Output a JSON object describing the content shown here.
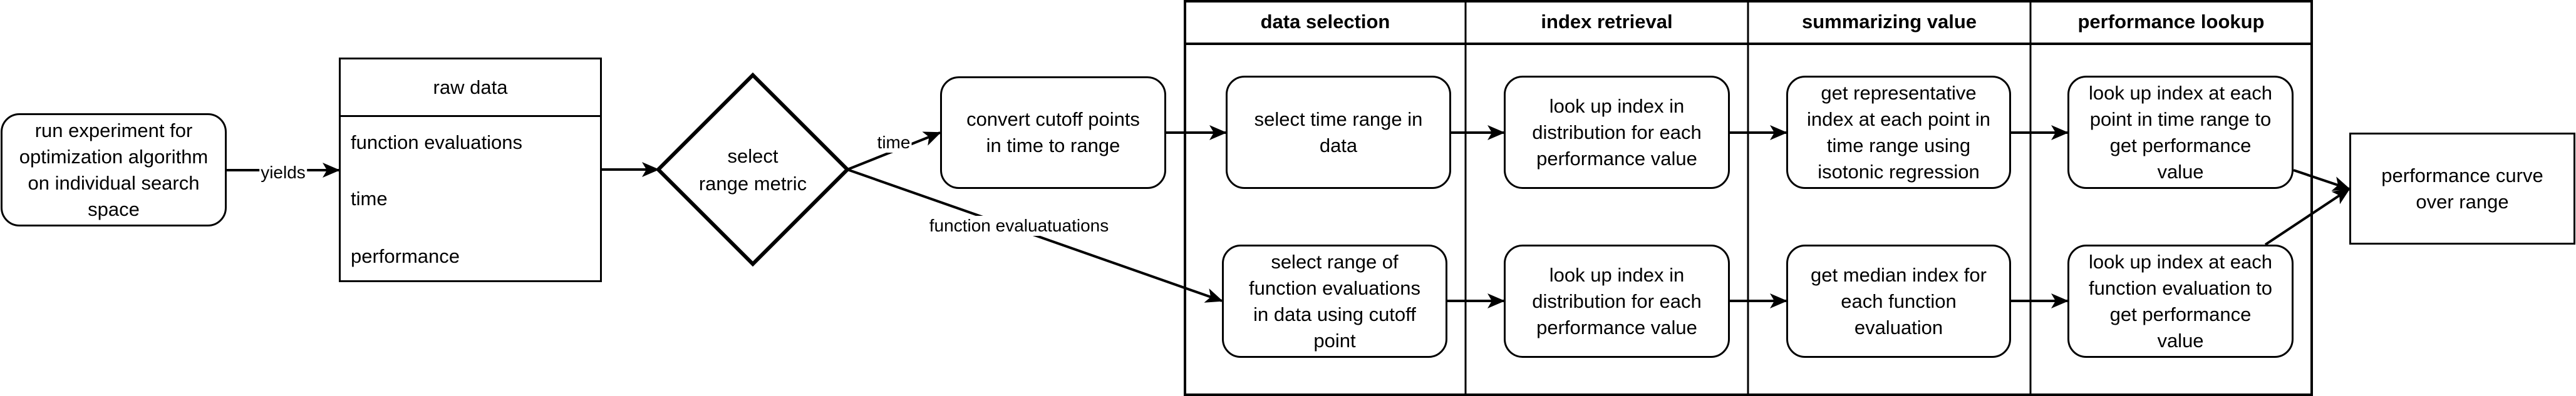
{
  "diagram": {
    "start_node": "run experiment for\noptimization algorithm\non individual search\nspace",
    "edge_yields": "yields",
    "raw_data": {
      "title": "raw data",
      "fields": [
        "function evaluations",
        "time",
        "performance"
      ]
    },
    "decision": "select\nrange metric",
    "edge_time": "time",
    "edge_function_evaluations": "function evaluatuations",
    "convert_node": "convert cutoff points\nin time to range",
    "lanes": [
      {
        "header": "data selection",
        "time_node": "select time range in\ndata",
        "fe_node": "select range of\nfunction evaluations\nin data using cutoff\npoint"
      },
      {
        "header": "index retrieval",
        "time_node": "look up index in\ndistribution for each\nperformance value",
        "fe_node": "look up index in\ndistribution for each\nperformance value"
      },
      {
        "header": "summarizing value",
        "time_node": "get representative\nindex at each point in\ntime range using\nisotonic regression",
        "fe_node": "get median index for\neach function\nevaluation"
      },
      {
        "header": "performance lookup",
        "time_node": "look up index at each\npoint in time range to\nget performance\nvalue",
        "fe_node": "look up index at each\nfunction evaluation to\nget performance\nvalue"
      }
    ],
    "end_node": "performance curve\nover range"
  }
}
